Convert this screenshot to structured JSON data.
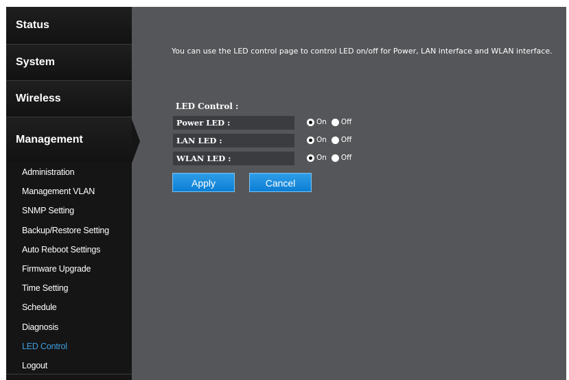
{
  "sidebar": {
    "status_label": "Status",
    "system_label": "System",
    "wireless_label": "Wireless",
    "management_label": "Management",
    "items": [
      {
        "label": "Administration"
      },
      {
        "label": "Management VLAN"
      },
      {
        "label": "SNMP Setting"
      },
      {
        "label": "Backup/Restore Setting"
      },
      {
        "label": "Auto Reboot Settings"
      },
      {
        "label": "Firmware Upgrade"
      },
      {
        "label": "Time Setting"
      },
      {
        "label": "Schedule"
      },
      {
        "label": "Diagnosis"
      },
      {
        "label": "LED Control"
      },
      {
        "label": "Logout"
      }
    ],
    "active_item": "LED Control",
    "active_color": "#3e9fe3"
  },
  "main": {
    "description": "You can use the LED control page to control LED on/off for Power, LAN interface and WLAN interface.",
    "section_title": "LED Control :",
    "rows": [
      {
        "label": "Power LED :",
        "on_label": "On",
        "off_label": "Off",
        "selected": "On"
      },
      {
        "label": "LAN LED :",
        "on_label": "On",
        "off_label": "Off",
        "selected": "On"
      },
      {
        "label": "WLAN LED :",
        "on_label": "On",
        "off_label": "Off",
        "selected": "On"
      }
    ],
    "apply_label": "Apply",
    "cancel_label": "Cancel"
  }
}
